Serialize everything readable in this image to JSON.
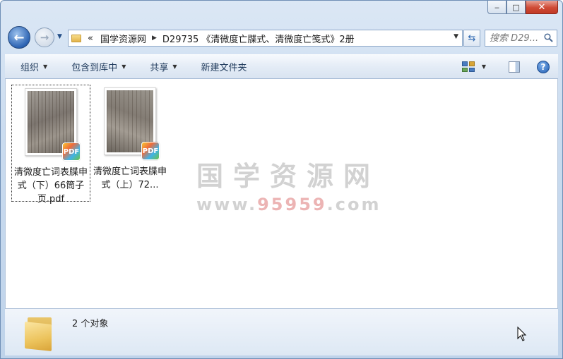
{
  "window": {
    "caption": {
      "minimize": "‒",
      "maximize": "□",
      "close": "✕"
    }
  },
  "nav": {
    "back_icon": "back-arrow-icon",
    "forward_icon": "forward-arrow-icon"
  },
  "address": {
    "overflow": "«",
    "segments": [
      "国学资源网",
      "D29735 《清微度亡牒式、清微度亡笺式》2册"
    ]
  },
  "search": {
    "placeholder": "搜索 D29..."
  },
  "toolbar": {
    "organize": "组织",
    "include_library": "包含到库中",
    "share": "共享",
    "new_folder": "新建文件夹"
  },
  "watermark": {
    "title": "国学资源网",
    "url_prefix": "www.",
    "url_number": "95959",
    "url_suffix": ".com"
  },
  "files": [
    {
      "name": "清微度亡词表牒申式（下）66筒子页.pdf",
      "badge": "PDF",
      "selected": true
    },
    {
      "name": "清微度亡词表牒申式（上）72...",
      "badge": "PDF",
      "selected": false
    }
  ],
  "status": {
    "count": "2 个对象"
  },
  "colors": {
    "accent": "#2c63b3",
    "close": "#cf4a35"
  }
}
